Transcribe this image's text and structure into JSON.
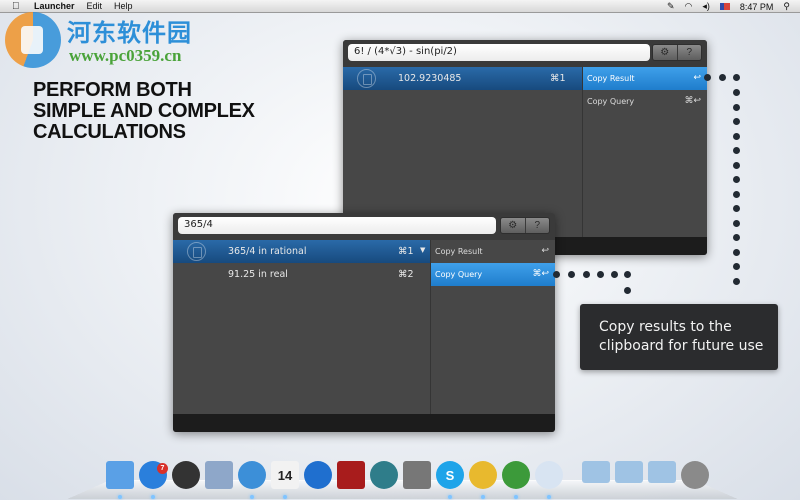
{
  "menubar": {
    "apple_icon": "apple-icon",
    "app_name": "Launcher",
    "menus": [
      "Edit",
      "Help"
    ],
    "status": {
      "icons": [
        "launcher-rocket-icon",
        "wifi-icon",
        "volume-icon",
        "flag-us-icon",
        "search-icon"
      ],
      "clock": "8:47 PM",
      "search_glyph": "⚲"
    }
  },
  "watermark": {
    "title": "河东软件园",
    "url": "www.pc0359.cn"
  },
  "headline": {
    "lines": [
      "PERFORM BOTH",
      "SIMPLE AND COMPLEX",
      "CALCULATIONS"
    ]
  },
  "window_back": {
    "query": "6! / (4*√3) - sin(pi/2)",
    "settings_glyph": "⚙",
    "help_glyph": "?",
    "results": [
      {
        "label": "102.9230485",
        "shortcut": "⌘1",
        "selected": true
      }
    ],
    "actions": [
      {
        "label": "Copy Result",
        "key": "↩",
        "selected": true
      },
      {
        "label": "Copy Query",
        "key": "⌘↩",
        "selected": false
      }
    ]
  },
  "window_front": {
    "query": "365/4",
    "settings_glyph": "⚙",
    "help_glyph": "?",
    "results": [
      {
        "label": "365/4 in rational",
        "shortcut": "⌘1",
        "arrow": "▼",
        "selected": true
      },
      {
        "label": "91.25 in real",
        "shortcut": "⌘2",
        "selected": false
      }
    ],
    "actions": [
      {
        "label": "Copy Result",
        "key": "↩",
        "selected": false
      },
      {
        "label": "Copy Query",
        "key": "⌘↩",
        "selected": true
      }
    ]
  },
  "callout": {
    "lines": [
      "Copy results to the",
      "clipboard for future use"
    ]
  },
  "dock": {
    "items": [
      {
        "name": "finder",
        "color": "#5aa0e6",
        "running": true
      },
      {
        "name": "app-store",
        "color": "#2a7fdc",
        "running": true,
        "badge": "7"
      },
      {
        "name": "dashboard",
        "color": "#333333",
        "running": false
      },
      {
        "name": "mail",
        "color": "#8ea7c9",
        "running": false
      },
      {
        "name": "safari",
        "color": "#3c8fd8",
        "running": true
      },
      {
        "name": "calendar",
        "color": "#f2f2f2",
        "running": true,
        "label": "14"
      },
      {
        "name": "itunes",
        "color": "#1f6fcf",
        "running": false
      },
      {
        "name": "photo-booth",
        "color": "#a81c1c",
        "running": false
      },
      {
        "name": "time-machine",
        "color": "#2f7d8a",
        "running": false
      },
      {
        "name": "system-preferences",
        "color": "#777777",
        "running": false
      },
      {
        "name": "skype",
        "color": "#1ea4e9",
        "running": true,
        "label": "S"
      },
      {
        "name": "chrome",
        "color": "#e8b92e",
        "running": true
      },
      {
        "name": "adium",
        "color": "#3c9a3a",
        "running": true
      },
      {
        "name": "launcher",
        "color": "#d8e4f2",
        "running": true
      },
      {
        "name": "applications-folder",
        "color": "#9fc3e4",
        "running": false
      },
      {
        "name": "documents-folder",
        "color": "#9fc3e4",
        "running": false
      },
      {
        "name": "downloads-folder",
        "color": "#9fc3e4",
        "running": false
      },
      {
        "name": "trash",
        "color": "#8a8a8a",
        "running": false
      }
    ]
  }
}
